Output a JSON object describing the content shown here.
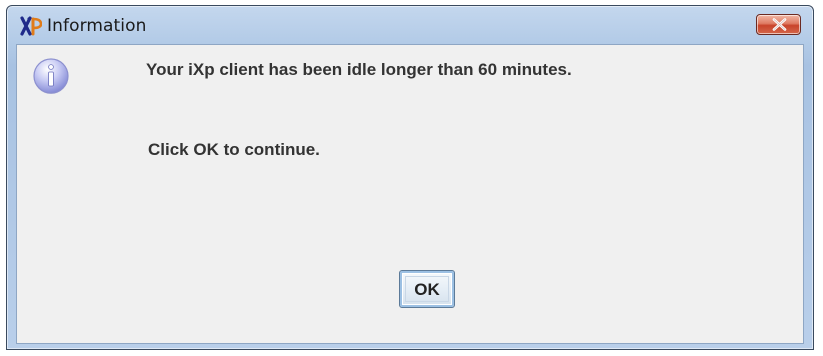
{
  "window": {
    "title": "Information",
    "app_icon": "ixp-app-icon",
    "close_icon": "close-icon"
  },
  "dialog": {
    "icon": "info-icon",
    "message_line1": "Your iXp client has been idle longer than 60 minutes.",
    "message_line2": "Click OK to continue."
  },
  "buttons": {
    "ok_label": "OK"
  },
  "colors": {
    "title_bar": "#b3cbe7",
    "content_bg": "#f0f0f0",
    "close_button": "#c8432a",
    "info_icon": "#8a8fd8",
    "text": "#333333"
  }
}
